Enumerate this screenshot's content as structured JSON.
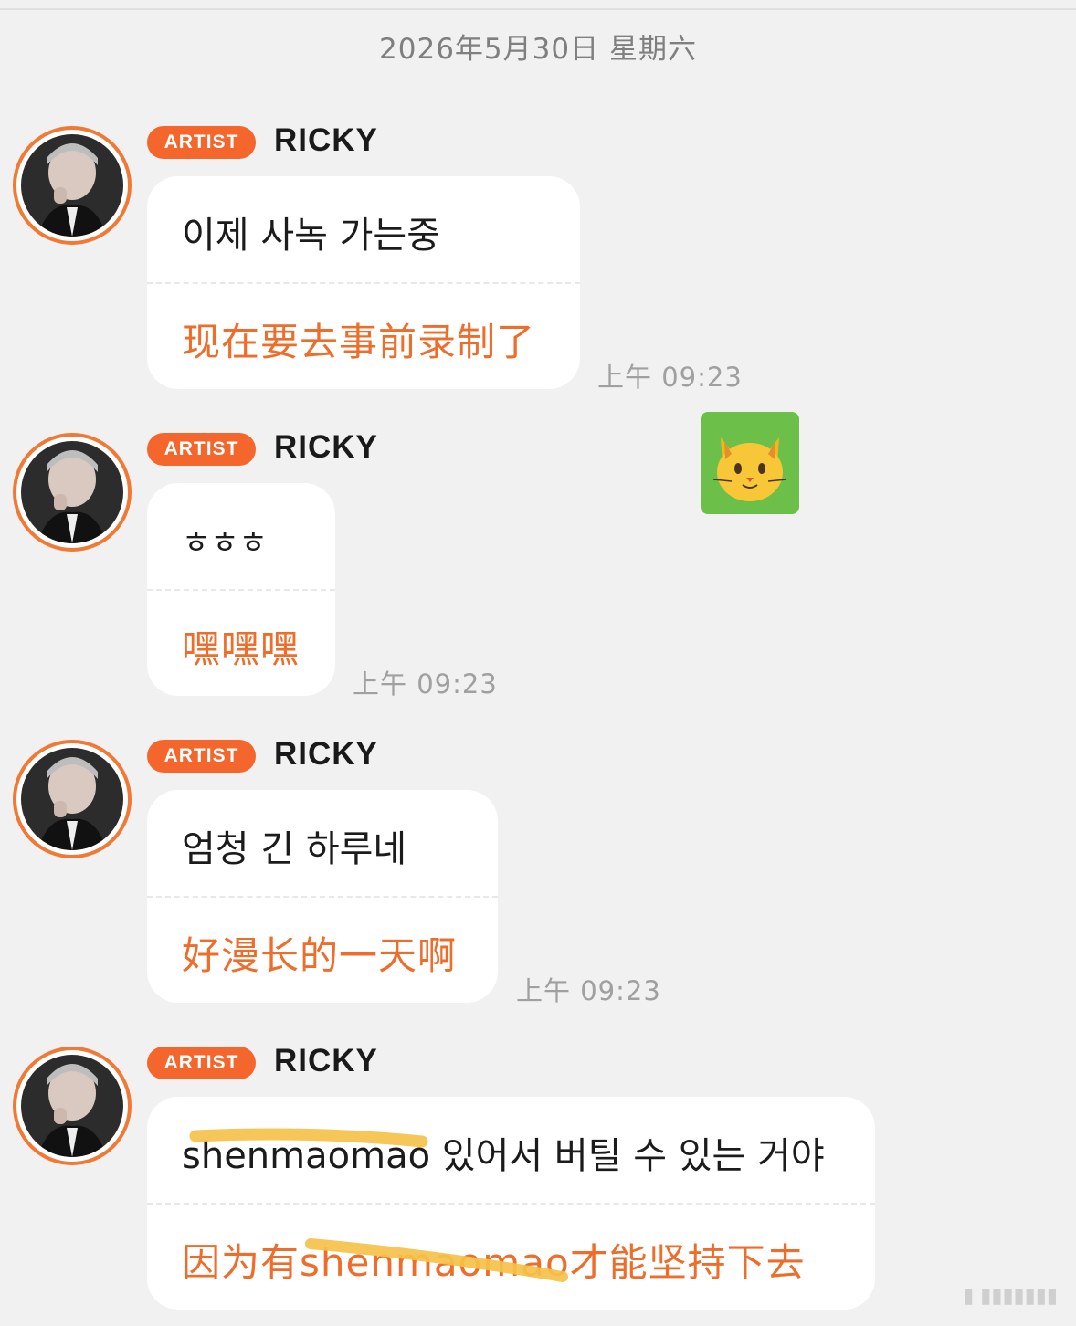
{
  "date_header": "2026年5月30日 星期六",
  "messages": [
    {
      "badge": "ARTIST",
      "sender": "RICKY",
      "original": "이제 사녹 가는중",
      "translation": "现在要去事前录制了",
      "time": "上午 09:23"
    },
    {
      "badge": "ARTIST",
      "sender": "RICKY",
      "original": "ㅎㅎㅎ",
      "translation": "嘿嘿嘿",
      "time": "上午 09:23"
    },
    {
      "badge": "ARTIST",
      "sender": "RICKY",
      "original": "엄청 긴 하루네",
      "translation": "好漫长的一天啊",
      "time": "上午 09:23"
    },
    {
      "badge": "ARTIST",
      "sender": "RICKY",
      "original": "shenmaomao 있어서 버틸 수 있는 거야",
      "translation": "因为有shenmaomao才能坚持下去"
    }
  ],
  "sticker": {
    "icon": "cat-face-icon",
    "glyph": "🐱",
    "background": "#6cc04a"
  },
  "colors": {
    "accent": "#f4662c",
    "translation": "#ee6d2a",
    "background": "#f1f1f1"
  }
}
